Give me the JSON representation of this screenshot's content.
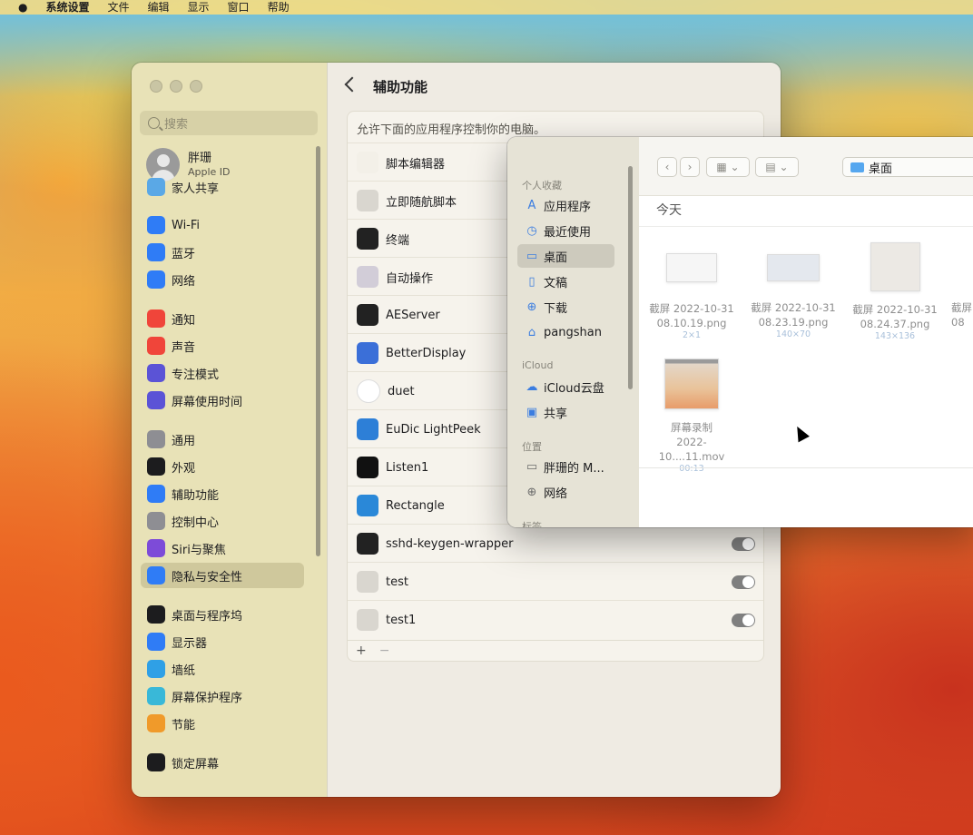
{
  "menubar": {
    "items": [
      "系统设置",
      "文件",
      "编辑",
      "显示",
      "窗口",
      "帮助"
    ]
  },
  "settings": {
    "search_placeholder": "搜索",
    "account": {
      "name": "胖珊",
      "sub": "Apple ID"
    },
    "sidebar": [
      {
        "label": "家人共享",
        "icon": "family-icon",
        "color": "#5aa8e6"
      },
      {
        "label": "Wi-Fi",
        "icon": "wifi-icon",
        "color": "#2f7cf6"
      },
      {
        "label": "蓝牙",
        "icon": "bluetooth-icon",
        "color": "#2f7cf6"
      },
      {
        "label": "网络",
        "icon": "globe-icon",
        "color": "#2f7cf6"
      },
      {
        "label": "通知",
        "icon": "bell-icon",
        "color": "#f0453a"
      },
      {
        "label": "声音",
        "icon": "speaker-icon",
        "color": "#f0453a"
      },
      {
        "label": "专注模式",
        "icon": "moon-icon",
        "color": "#5b53d6"
      },
      {
        "label": "屏幕使用时间",
        "icon": "hourglass-icon",
        "color": "#5b53d6"
      },
      {
        "label": "通用",
        "icon": "gear-icon",
        "color": "#8e8e93"
      },
      {
        "label": "外观",
        "icon": "appearance-icon",
        "color": "#1c1c1e"
      },
      {
        "label": "辅助功能",
        "icon": "accessibility-icon",
        "color": "#2f7cf6"
      },
      {
        "label": "控制中心",
        "icon": "control-center-icon",
        "color": "#8e8e93"
      },
      {
        "label": "Siri与聚焦",
        "icon": "siri-icon",
        "color": "#7d4bd8"
      },
      {
        "label": "隐私与安全性",
        "icon": "hand-icon",
        "color": "#2f7cf6"
      },
      {
        "label": "桌面与程序坞",
        "icon": "dock-icon",
        "color": "#1c1c1e"
      },
      {
        "label": "显示器",
        "icon": "sun-icon",
        "color": "#2f7cf6"
      },
      {
        "label": "墙纸",
        "icon": "flower-icon",
        "color": "#2fa0e6"
      },
      {
        "label": "屏幕保护程序",
        "icon": "screensaver-icon",
        "color": "#39b8d8"
      },
      {
        "label": "节能",
        "icon": "bulb-icon",
        "color": "#f09a2a"
      },
      {
        "label": "锁定屏幕",
        "icon": "lock-icon",
        "color": "#1c1c1e"
      }
    ],
    "content_title": "辅助功能",
    "panel_desc": "允许下面的应用程序控制你的电脑。",
    "apps": [
      {
        "name": "脚本编辑器",
        "icon": "script-editor-icon",
        "toggle": false
      },
      {
        "name": "立即随航脚本",
        "icon": "script-icon",
        "toggle": false
      },
      {
        "name": "终端",
        "icon": "terminal-icon",
        "toggle": false
      },
      {
        "name": "自动操作",
        "icon": "automator-icon",
        "toggle": false
      },
      {
        "name": "AEServer",
        "icon": "terminal-icon",
        "toggle": false
      },
      {
        "name": "BetterDisplay",
        "icon": "display-icon",
        "toggle": false
      },
      {
        "name": "duet",
        "icon": "duet-icon",
        "toggle": false
      },
      {
        "name": "EuDic LightPeek",
        "icon": "eudic-icon",
        "toggle": false
      },
      {
        "name": "Listen1",
        "icon": "listen1-icon",
        "toggle": false
      },
      {
        "name": "Rectangle",
        "icon": "rectangle-icon",
        "toggle": false
      },
      {
        "name": "sshd-keygen-wrapper",
        "icon": "terminal-icon",
        "toggle": true
      },
      {
        "name": "test",
        "icon": "script-icon",
        "toggle": true
      },
      {
        "name": "test1",
        "icon": "script-icon",
        "toggle": true
      }
    ],
    "footer": {
      "add": "+",
      "remove": "−"
    }
  },
  "dialog": {
    "sections": {
      "favorites": "个人收藏",
      "icloud": "iCloud",
      "locations": "位置",
      "tags": "标签"
    },
    "favorites": [
      {
        "label": "应用程序",
        "icon": "apps-icon"
      },
      {
        "label": "最近使用",
        "icon": "clock-icon"
      },
      {
        "label": "桌面",
        "icon": "desktop-icon"
      },
      {
        "label": "文稿",
        "icon": "document-icon"
      },
      {
        "label": "下载",
        "icon": "download-icon"
      },
      {
        "label": "pangshan",
        "icon": "home-icon"
      }
    ],
    "icloud": [
      {
        "label": "iCloud云盘",
        "icon": "cloud-icon"
      },
      {
        "label": "共享",
        "icon": "shared-folder-icon"
      }
    ],
    "locations": [
      {
        "label": "胖珊的 M...",
        "icon": "disk-icon"
      },
      {
        "label": "网络",
        "icon": "network-icon"
      }
    ],
    "location_path": "桌面",
    "group_title": "今天",
    "files": [
      {
        "name1": "截屏 2022-10-31",
        "name2": "08.10.19.png",
        "size": "2×1"
      },
      {
        "name1": "截屏 2022-10-31",
        "name2": "08.23.19.png",
        "size": "140×70"
      },
      {
        "name1": "截屏 2022-10-31",
        "name2": "08.24.37.png",
        "size": "143×136"
      },
      {
        "name1": "截屏",
        "name2": "08",
        "size": ""
      },
      {
        "name1": "屏幕录制",
        "name2": "2022-10....11.mov",
        "size": "00:13"
      }
    ]
  }
}
